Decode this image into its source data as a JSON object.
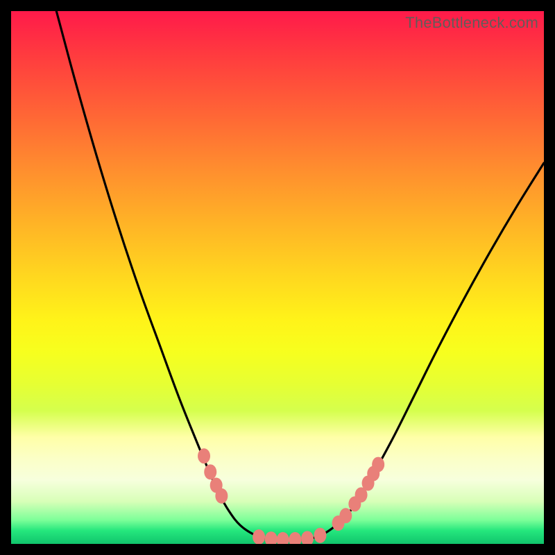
{
  "watermark": "TheBottleneck.com",
  "chart_data": {
    "type": "line",
    "title": "",
    "xlabel": "",
    "ylabel": "",
    "xlim": [
      0,
      100
    ],
    "ylim": [
      0,
      100
    ],
    "description": "V-shaped bottleneck curve over a vertical heatmap gradient (red at top = high bottleneck, green at bottom = no bottleneck). The black curve descends from upper-left, reaches a flat minimum near the bottom center, and rises toward the upper-right. Salmon-colored data markers cluster along the lower portions of both arms and along the flat minimum.",
    "gradient_stops": [
      {
        "pos": 0.0,
        "color": "#ff1a4a"
      },
      {
        "pos": 0.2,
        "color": "#ff6835"
      },
      {
        "pos": 0.4,
        "color": "#ffb426"
      },
      {
        "pos": 0.58,
        "color": "#fff319"
      },
      {
        "pos": 0.8,
        "color": "#ffffa8"
      },
      {
        "pos": 0.95,
        "color": "#7dff99"
      },
      {
        "pos": 1.0,
        "color": "#10c46c"
      }
    ],
    "curve_points": [
      {
        "x": 8.5,
        "y": 100.0
      },
      {
        "x": 12.0,
        "y": 87.0
      },
      {
        "x": 16.0,
        "y": 73.0
      },
      {
        "x": 20.0,
        "y": 60.0
      },
      {
        "x": 24.0,
        "y": 48.0
      },
      {
        "x": 28.0,
        "y": 37.0
      },
      {
        "x": 31.5,
        "y": 27.5
      },
      {
        "x": 34.5,
        "y": 20.0
      },
      {
        "x": 37.0,
        "y": 14.0
      },
      {
        "x": 39.0,
        "y": 9.5
      },
      {
        "x": 41.0,
        "y": 6.0
      },
      {
        "x": 43.0,
        "y": 3.5
      },
      {
        "x": 45.5,
        "y": 1.8
      },
      {
        "x": 48.0,
        "y": 1.0
      },
      {
        "x": 52.0,
        "y": 0.8
      },
      {
        "x": 56.0,
        "y": 1.0
      },
      {
        "x": 58.5,
        "y": 1.8
      },
      {
        "x": 61.0,
        "y": 3.5
      },
      {
        "x": 63.5,
        "y": 6.0
      },
      {
        "x": 66.0,
        "y": 9.5
      },
      {
        "x": 68.5,
        "y": 14.0
      },
      {
        "x": 72.0,
        "y": 20.5
      },
      {
        "x": 76.0,
        "y": 28.5
      },
      {
        "x": 80.0,
        "y": 36.5
      },
      {
        "x": 85.0,
        "y": 46.0
      },
      {
        "x": 90.0,
        "y": 55.0
      },
      {
        "x": 95.0,
        "y": 63.5
      },
      {
        "x": 100.0,
        "y": 71.5
      }
    ],
    "markers": [
      {
        "x": 36.2,
        "y": 16.5
      },
      {
        "x": 37.4,
        "y": 13.5
      },
      {
        "x": 38.5,
        "y": 11.0
      },
      {
        "x": 39.5,
        "y": 9.0
      },
      {
        "x": 46.5,
        "y": 1.3
      },
      {
        "x": 48.8,
        "y": 0.9
      },
      {
        "x": 51.0,
        "y": 0.8
      },
      {
        "x": 53.3,
        "y": 0.8
      },
      {
        "x": 55.6,
        "y": 1.0
      },
      {
        "x": 58.0,
        "y": 1.6
      },
      {
        "x": 61.4,
        "y": 3.9
      },
      {
        "x": 62.8,
        "y": 5.3
      },
      {
        "x": 64.5,
        "y": 7.5
      },
      {
        "x": 65.7,
        "y": 9.2
      },
      {
        "x": 67.0,
        "y": 11.4
      },
      {
        "x": 68.0,
        "y": 13.2
      },
      {
        "x": 68.9,
        "y": 14.9
      }
    ],
    "marker_color": "#e98079",
    "curve_color": "#000000"
  }
}
